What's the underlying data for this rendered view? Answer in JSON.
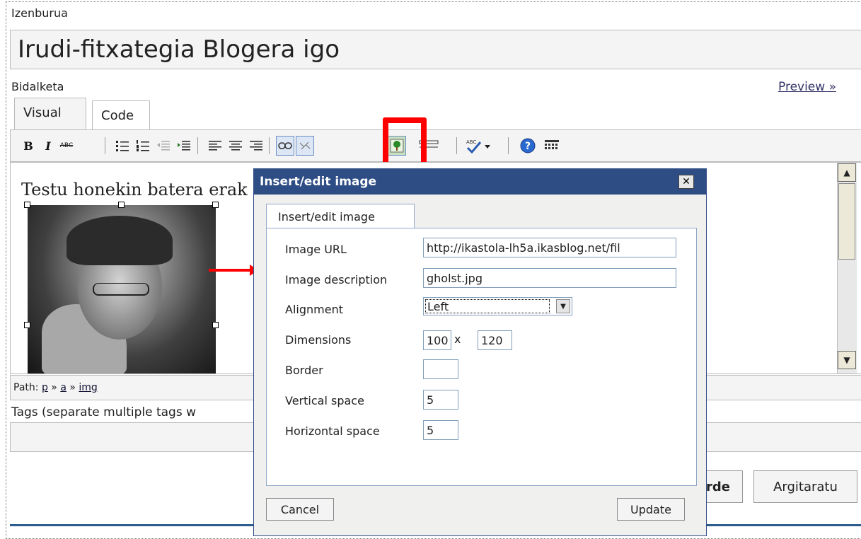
{
  "post": {
    "title_label": "Izenburua",
    "title_value": "Irudi-fitxategia Blogera igo",
    "body_label": "Bidalketa",
    "preview_link": "Preview »",
    "tabs": [
      "Visual",
      "Code"
    ],
    "editor_text": "Testu honekin batera erak",
    "path_label": "Path:",
    "path_items": [
      "p",
      "a",
      "img"
    ],
    "path_sep": "»",
    "tags_label": "Tags (separate multiple tags w",
    "save_button": "rde",
    "publish_button": "Argitaratu"
  },
  "toolbar": {
    "bold": "B",
    "italic": "I",
    "strike": "ABC",
    "spell": "ABC",
    "help": "?"
  },
  "dialog": {
    "title": "Insert/edit image",
    "close": "✕",
    "tab": "Insert/edit image",
    "fields": {
      "image_url_label": "Image URL",
      "image_url_value": "http://ikastola-lh5a.ikasblog.net/fil",
      "description_label": "Image description",
      "description_value": "gholst.jpg",
      "alignment_label": "Alignment",
      "alignment_value": "Left",
      "dimensions_label": "Dimensions",
      "width_value": "100",
      "dim_separator": "x",
      "height_value": "120",
      "border_label": "Border",
      "border_value": "",
      "vspace_label": "Vertical space",
      "vspace_value": "5",
      "hspace_label": "Horizontal space",
      "hspace_value": "5"
    },
    "cancel": "Cancel",
    "update": "Update"
  },
  "colors": {
    "highlight": "#ff0000",
    "dialog_title_bg": "#2e4d84"
  }
}
